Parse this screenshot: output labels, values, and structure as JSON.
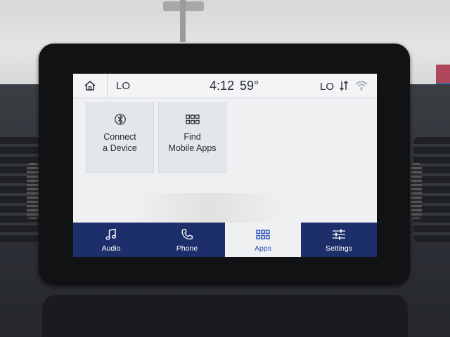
{
  "status_bar": {
    "left_status": "LO",
    "time": "4:12",
    "temperature": "59°",
    "right_status": "LO",
    "icons": [
      "home-icon",
      "sort-arrows-icon",
      "wifi-icon"
    ]
  },
  "tiles": [
    {
      "icon": "bluetooth-icon",
      "label": "Connect\na Device"
    },
    {
      "icon": "apps-grid-icon",
      "label": "Find\nMobile Apps"
    }
  ],
  "nav": [
    {
      "icon": "music-note-icon",
      "label": "Audio",
      "active": false
    },
    {
      "icon": "phone-icon",
      "label": "Phone",
      "active": false
    },
    {
      "icon": "apps-grid-icon",
      "label": "Apps",
      "active": true
    },
    {
      "icon": "sliders-icon",
      "label": "Settings",
      "active": false
    }
  ],
  "colors": {
    "nav_background": "#1d2f6a",
    "active_tab_text": "#2f52b8",
    "screen_background": "#eef0f2"
  }
}
